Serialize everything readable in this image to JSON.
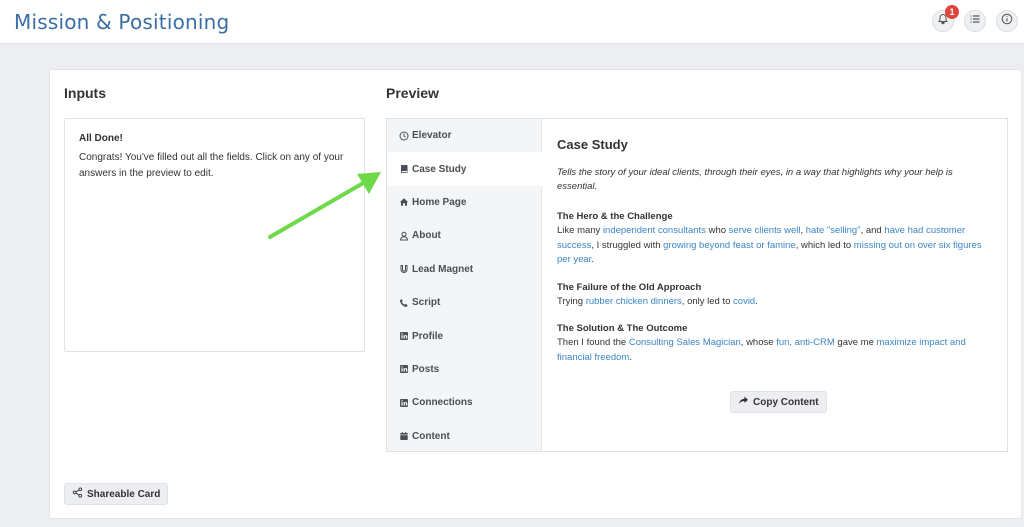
{
  "app": {
    "title": "Mission & Positioning"
  },
  "topbar": {
    "notification_count": "1"
  },
  "inputs": {
    "title": "Inputs",
    "done_heading": "All Done!",
    "done_text": "Congrats! You've filled out all the fields. Click on any of your answers in the preview to edit."
  },
  "preview": {
    "title": "Preview",
    "tabs": [
      {
        "label": "Elevator",
        "icon": "clock-icon"
      },
      {
        "label": "Case Study",
        "icon": "book-icon",
        "active": true
      },
      {
        "label": "Home Page",
        "icon": "home-icon"
      },
      {
        "label": "About",
        "icon": "user-icon"
      },
      {
        "label": "Lead Magnet",
        "icon": "magnet-icon"
      },
      {
        "label": "Script",
        "icon": "phone-icon"
      },
      {
        "label": "Profile",
        "icon": "linkedin-icon"
      },
      {
        "label": "Posts",
        "icon": "linkedin-icon"
      },
      {
        "label": "Connections",
        "icon": "linkedin-icon"
      },
      {
        "label": "Content",
        "icon": "calendar-icon"
      }
    ],
    "content": {
      "title": "Case Study",
      "intro": "Tells the story of your ideal clients, through their eyes, in a way that highlights why your help is essential.",
      "hero": {
        "heading": "The Hero & the Challenge",
        "t1": "Like many ",
        "h1": "independent consultants",
        "t2": " who ",
        "h2": "serve clients well",
        "t3": ", ",
        "h3": "hate \"selling\"",
        "t4": ", and ",
        "h4": "have had customer success",
        "t5": ", I struggled with ",
        "h5": "growing beyond feast or famine",
        "t6": ", which led to ",
        "h6": "missing out on over six figures per year",
        "t7": "."
      },
      "failure": {
        "heading": "The Failure of the Old Approach",
        "t1": "Trying ",
        "h1": "rubber chicken dinners",
        "t2": ", only led to ",
        "h2": "covid",
        "t3": "."
      },
      "solution": {
        "heading": "The Solution & The Outcome",
        "t1": "Then I found the ",
        "h1": "Consulting Sales Magician",
        "t2": ", whose ",
        "h2": "fun, anti-CRM",
        "t3": " gave me ",
        "h3": "maximize impact and financial freedom",
        "t4": "."
      },
      "copy_label": "Copy Content"
    }
  },
  "footer": {
    "share_label": "Shareable Card"
  },
  "colors": {
    "accent": "#3a6ea5",
    "link": "#3b86c6",
    "badge": "#e0443b",
    "arrow": "#6fd94a"
  }
}
